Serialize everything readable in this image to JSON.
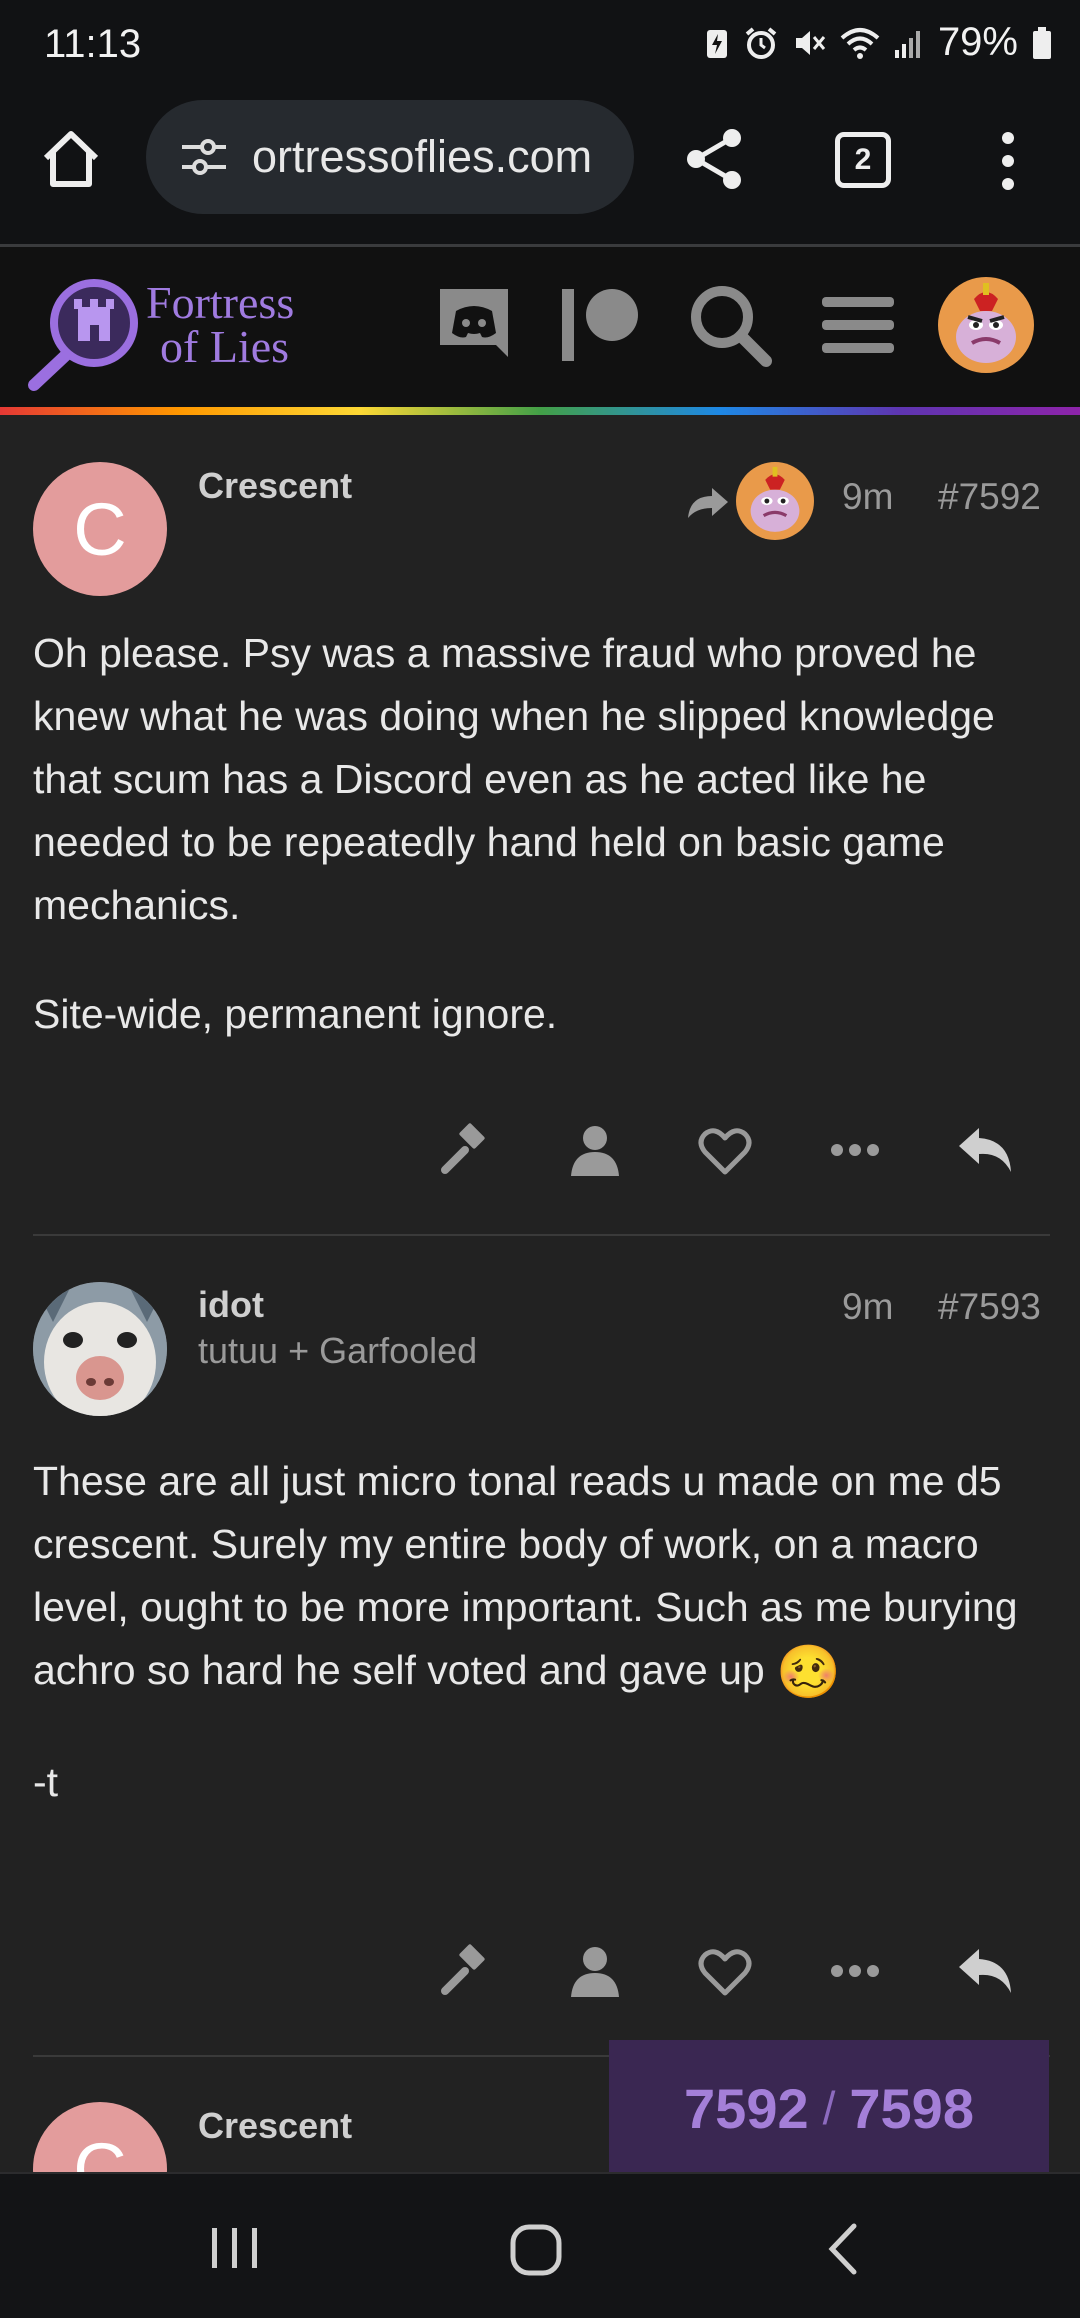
{
  "status_bar": {
    "time": "11:13",
    "battery": "79%",
    "icons": [
      "battery-saver-icon",
      "alarm-icon",
      "mute-icon",
      "wifi-icon",
      "signal-icon",
      "battery-icon"
    ]
  },
  "browser": {
    "url": "ortressoflies.com",
    "tab_count": "2",
    "icons": [
      "home-icon",
      "site-settings-icon",
      "share-icon",
      "tabs-icon",
      "menu-dots-icon"
    ]
  },
  "site": {
    "logo_line1": "Fortress",
    "logo_line2": "of Lies",
    "nav_icons": [
      "discord-icon",
      "patreon-icon",
      "search-icon",
      "hamburger-icon",
      "user-avatar"
    ]
  },
  "posts": [
    {
      "avatar_letter": "C",
      "username": "Crescent",
      "time": "9m",
      "number": "#7592",
      "paragraphs": [
        "Oh please. Psy was a massive fraud who proved he knew what he was doing when he slipped knowledge that scum has a Discord even as he acted like he needed to be repeatedly hand held on basic game mechanics.",
        "Site-wide, permanent ignore."
      ]
    },
    {
      "username": "idot",
      "subtitle": "tutuu + Garfooled",
      "time": "9m",
      "number": "#7593",
      "paragraphs": [
        "These are all just micro tonal reads u made on me d5 crescent. Surely my entire body of work, on a macro level, ought to be more important. Such as me burying achro so hard he self voted and gave up",
        "-t"
      ],
      "emoji": "🥴"
    },
    {
      "avatar_letter": "C",
      "username": "Crescent"
    }
  ],
  "progress": {
    "current": "7592",
    "total": "7598",
    "separator": "/"
  },
  "colors": {
    "accent": "#a47fd8",
    "avatar_c": "#e39c9c",
    "background": "#222222"
  }
}
